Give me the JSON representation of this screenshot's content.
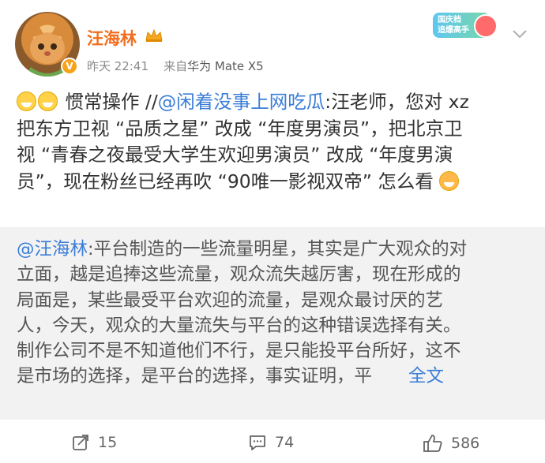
{
  "author": {
    "name": "汪海林",
    "time": "昨天 22:41",
    "source_prefix": "来自",
    "device": "华为 Mate X5",
    "verified_mark": "V"
  },
  "promo": {
    "line1": "国庆档",
    "line2": "追爆高手"
  },
  "post": {
    "lead": "惯常操作 //",
    "mention": "@闲着没事上网吃瓜",
    "line1_rest": ":汪老师，您对 xz",
    "line2": "把东方卫视 “品质之星” 改成 “年度男演员”，把北京卫",
    "line3": "视 “青春之夜最受大学生欢迎男演员” 改成 “年度男演",
    "line4": "员”，现在粉丝已经再吹 “90唯一影视双帝” 怎么看"
  },
  "repost": {
    "mention": "@汪海林",
    "line1_rest": ":平台制造的一些流量明星，其实是广大观众的对",
    "line2": "立面，越是追捧这些流量，观众流失越厉害，现在形成的",
    "line3": "局面是，某些最受平台欢迎的流量，是观众最讨厌的艺",
    "line4": "人，今天，观众的大量流失与平台的这种错误选择有关。",
    "line5": "制作公司不是不知道他们不行，是只能投平台所好，这不",
    "line6": "是市场的选择，是平台的选择，事实证明，平",
    "full_text_link": "全文"
  },
  "footer": {
    "reposts": "15",
    "comments": "74",
    "likes": "586"
  },
  "colors": {
    "username": "#f26d1d",
    "link": "#3b7dd8",
    "repost_bg": "#f2f2f2"
  },
  "icons": [
    "avatar",
    "verified-badge-icon",
    "crown-icon",
    "promo-badge",
    "chevron-down-icon",
    "grin-emoji-icon",
    "drool-emoji-icon",
    "repost-icon",
    "comment-icon",
    "like-icon"
  ]
}
